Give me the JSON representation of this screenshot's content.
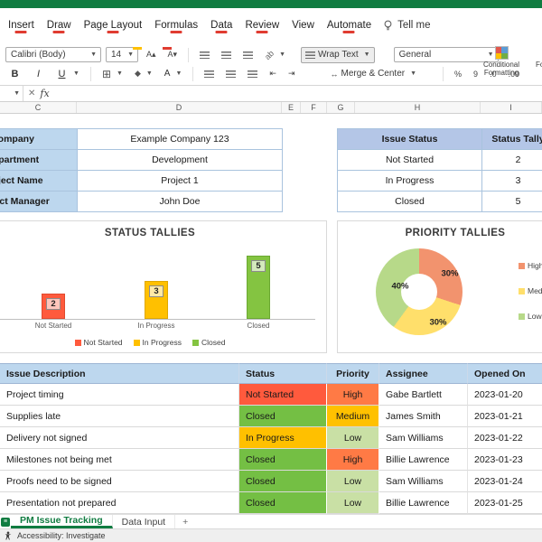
{
  "menu": {
    "items": [
      {
        "label": "Insert",
        "marked": true
      },
      {
        "label": "Draw",
        "marked": true
      },
      {
        "label": "Page Layout",
        "marked": true
      },
      {
        "label": "Formulas",
        "marked": true
      },
      {
        "label": "Data",
        "marked": true
      },
      {
        "label": "Review",
        "marked": true
      },
      {
        "label": "View",
        "marked": false
      },
      {
        "label": "Automate",
        "marked": true
      }
    ],
    "tellme": "Tell me"
  },
  "ribbon": {
    "font_name": "Calibri (Body)",
    "font_size": "14",
    "wrap_text": "Wrap Text",
    "merge_center": "Merge & Center",
    "number_format": "General",
    "conditional_formatting": "Conditional Formatting",
    "format_as_table": "Format as Table"
  },
  "formula_bar": {
    "fx": "fx",
    "cancel": "✕"
  },
  "columns": [
    "C",
    "D",
    "E",
    "F",
    "G",
    "H",
    "I"
  ],
  "info_table": {
    "rows": [
      {
        "label": "Company",
        "value": "Example Company 123"
      },
      {
        "label": "Department",
        "value": "Development"
      },
      {
        "label": "Project Name",
        "value": "Project 1"
      },
      {
        "label": "Project Manager",
        "value": "John Doe"
      }
    ]
  },
  "status_table": {
    "headers": [
      "Issue Status",
      "Status Tally"
    ],
    "rows": [
      [
        "Not Started",
        "2"
      ],
      [
        "In Progress",
        "3"
      ],
      [
        "Closed",
        "5"
      ]
    ]
  },
  "chart_data": [
    {
      "type": "bar",
      "title": "STATUS TALLIES",
      "categories": [
        "Not Started",
        "In Progress",
        "Closed"
      ],
      "values": [
        2,
        3,
        5
      ],
      "ylim": [
        0,
        5
      ],
      "colors": [
        "#FF5A3D",
        "#FFC000",
        "#84C441"
      ],
      "border_colors": [
        "#E04A2F",
        "#DFA800",
        "#6BA832"
      ],
      "legend": [
        "Not Started",
        "In Progress",
        "Closed"
      ],
      "legend_position": "bottom"
    },
    {
      "type": "pie",
      "title": "PRIORITY TALLIES",
      "labels": [
        "High",
        "Medium",
        "Low"
      ],
      "values": [
        30,
        30,
        40
      ],
      "display": [
        "30%",
        "30%",
        "40%"
      ],
      "colors": [
        "#F2936E",
        "#FFDF6B",
        "#B7D989"
      ],
      "legend_position": "right"
    }
  ],
  "issues_table": {
    "headers": [
      "Issue Description",
      "Status",
      "Priority",
      "Assignee",
      "Opened On"
    ],
    "rows": [
      {
        "description": "Project timing",
        "status": "Not Started",
        "priority": "High",
        "assignee": "Gabe Bartlett",
        "opened": "2023-01-20"
      },
      {
        "description": "Supplies late",
        "status": "Closed",
        "priority": "Medium",
        "assignee": "James Smith",
        "opened": "2023-01-21"
      },
      {
        "description": "Delivery not signed",
        "status": "In Progress",
        "priority": "Low",
        "assignee": "Sam Williams",
        "opened": "2023-01-22"
      },
      {
        "description": "Milestones not being met",
        "status": "Closed",
        "priority": "High",
        "assignee": "Billie Lawrence",
        "opened": "2023-01-23"
      },
      {
        "description": "Proofs need to be signed",
        "status": "Closed",
        "priority": "Low",
        "assignee": "Sam Williams",
        "opened": "2023-01-24"
      },
      {
        "description": "Presentation not prepared",
        "status": "Closed",
        "priority": "Low",
        "assignee": "Billie Lawrence",
        "opened": "2023-01-25"
      }
    ]
  },
  "status_colors": {
    "Not Started": "#FF5A3D",
    "In Progress": "#FFC000",
    "Closed": "#74BF44"
  },
  "priority_colors": {
    "High": "#FF7A45",
    "Medium": "#FFC100",
    "Low": "#C9E0A5"
  },
  "sheet_tabs": {
    "active": "PM Issue Tracking",
    "tabs": [
      "PM Issue Tracking",
      "Data Input"
    ],
    "add": "+"
  },
  "status_bar": {
    "text": "Accessibility: Investigate"
  },
  "brand": {
    "excel_green": "#107C41"
  }
}
